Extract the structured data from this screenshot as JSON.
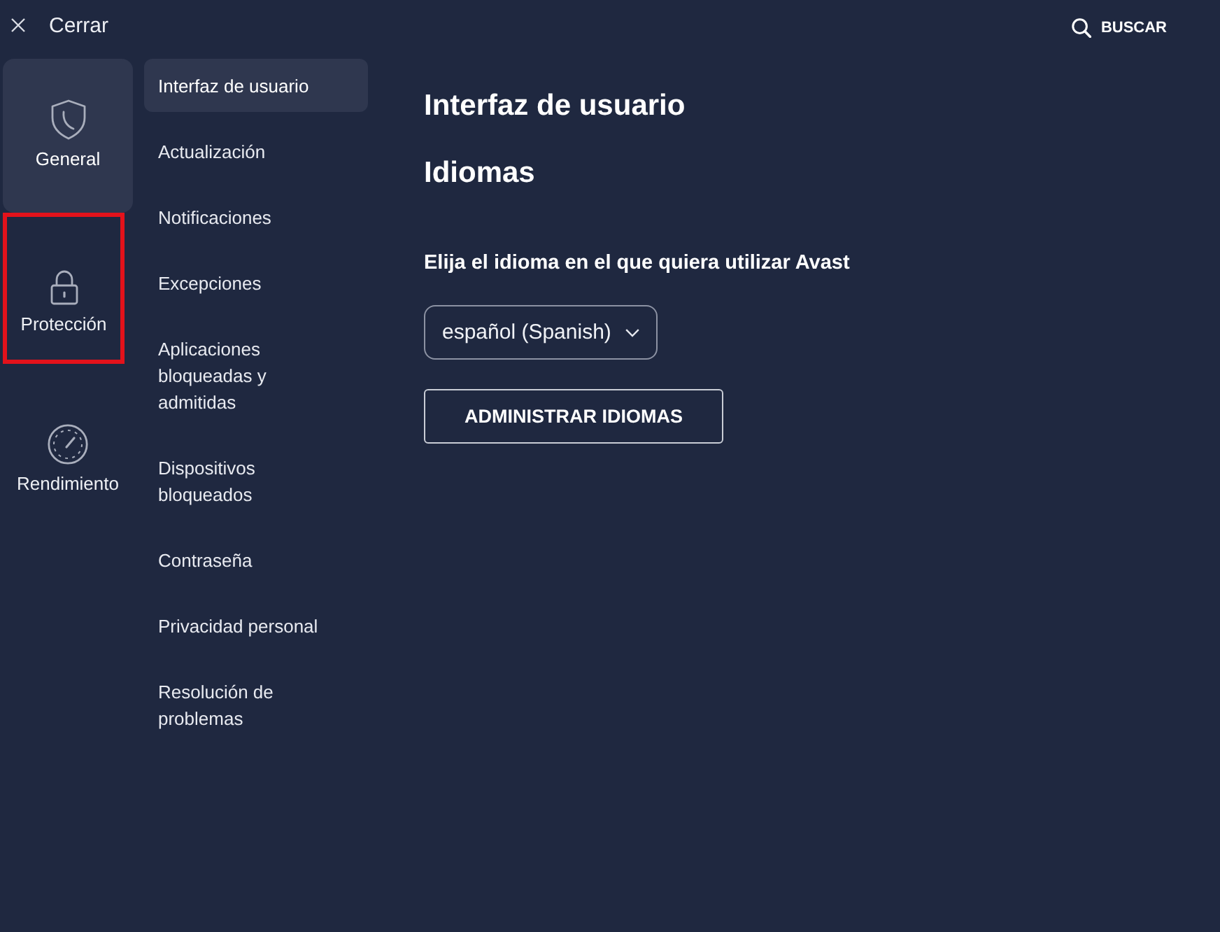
{
  "top_bar": {
    "close_label": "Cerrar",
    "search_label": "BUSCAR"
  },
  "categories": [
    {
      "label": "General",
      "kind": "shield",
      "selected": true,
      "highlighted": false
    },
    {
      "label": "Protección",
      "kind": "lock",
      "selected": false,
      "highlighted": true
    },
    {
      "label": "Rendimiento",
      "kind": "gauge",
      "selected": false,
      "highlighted": false
    }
  ],
  "subnav": {
    "items": [
      {
        "label": "Interfaz de usuario",
        "selected": true
      },
      {
        "label": "Actualización",
        "selected": false
      },
      {
        "label": "Notificaciones",
        "selected": false
      },
      {
        "label": "Excepciones",
        "selected": false
      },
      {
        "label": "Aplicaciones bloqueadas y admitidas",
        "selected": false
      },
      {
        "label": "Dispositivos bloqueados",
        "selected": false
      },
      {
        "label": "Contraseña",
        "selected": false
      },
      {
        "label": "Privacidad personal",
        "selected": false
      },
      {
        "label": "Resolución de problemas",
        "selected": false
      }
    ]
  },
  "content": {
    "title": "Interfaz de usuario",
    "section_title": "Idiomas",
    "prompt": "Elija el idioma en el que quiera utilizar Avast",
    "language_select": {
      "value": "español (Spanish)"
    },
    "manage_button": "ADMINISTRAR IDIOMAS"
  }
}
